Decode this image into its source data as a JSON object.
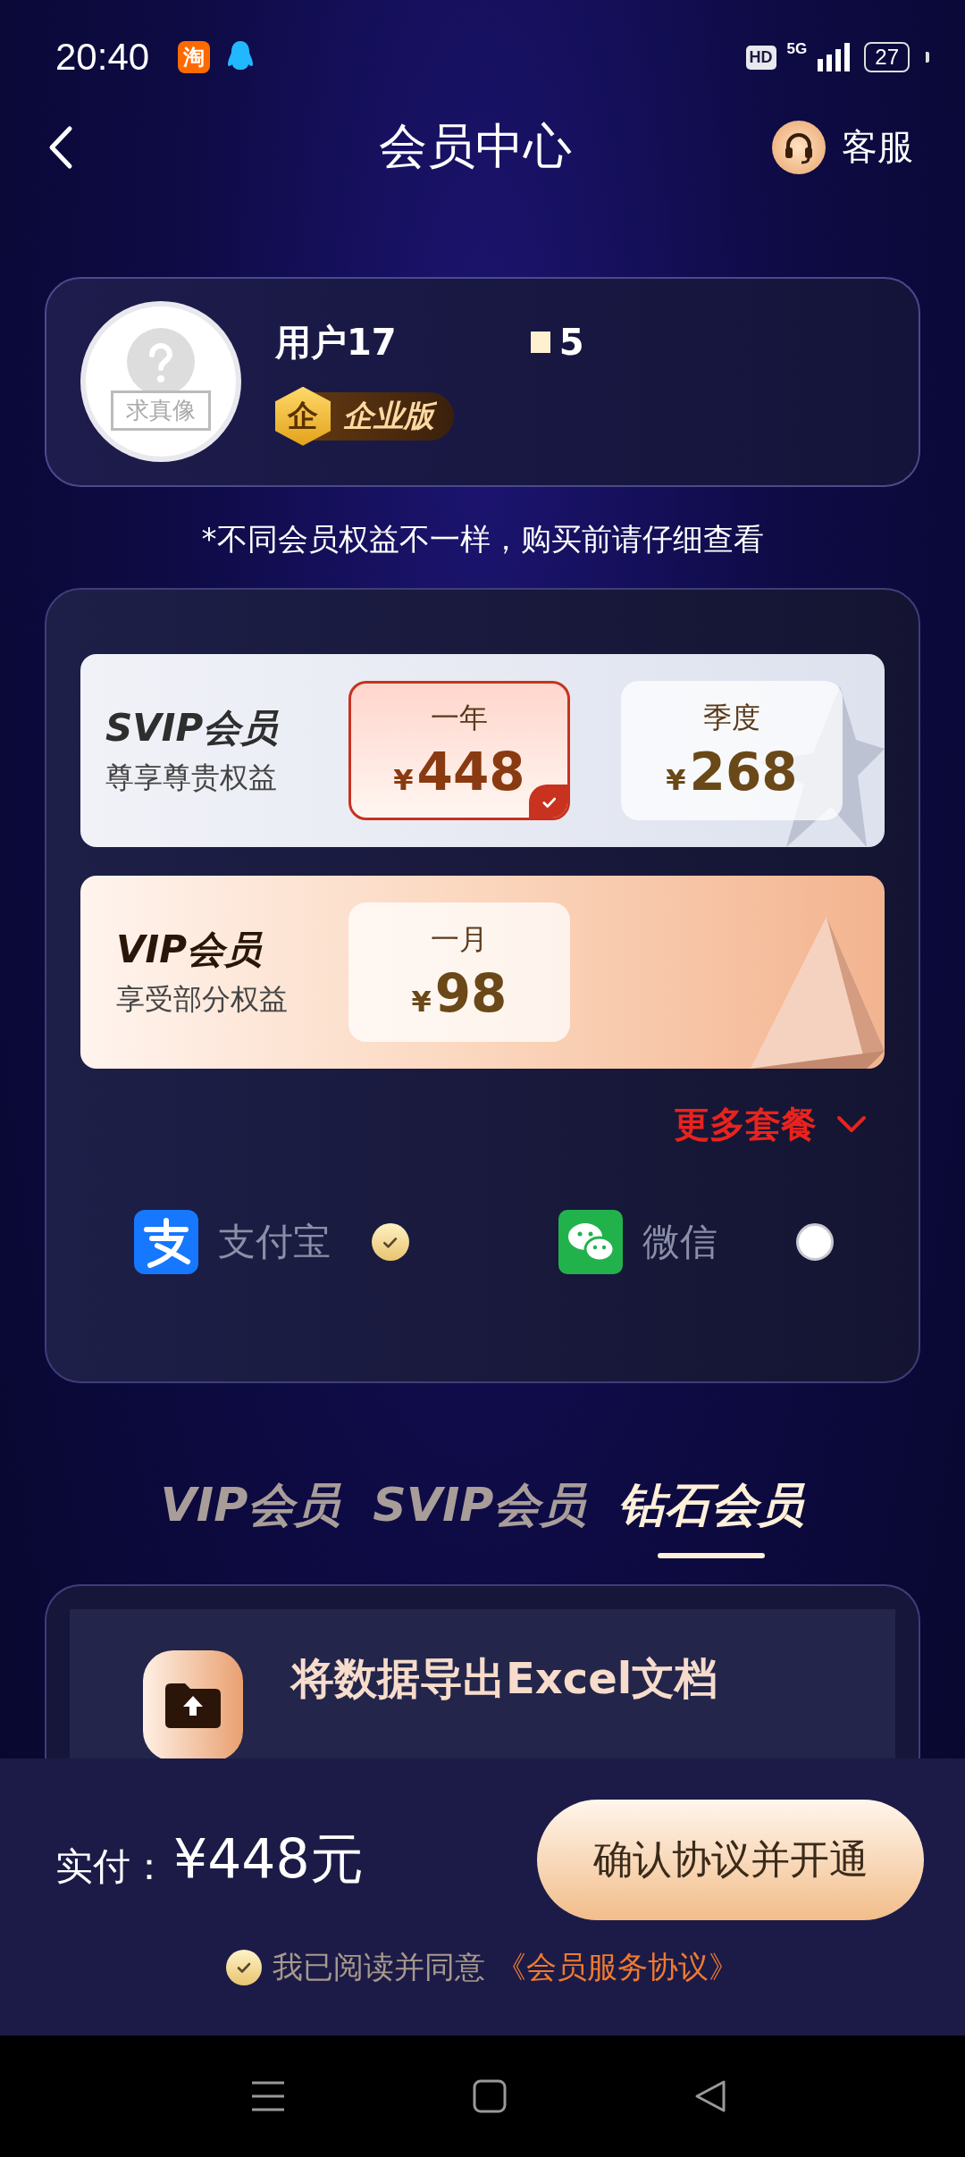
{
  "status_bar": {
    "time": "20:40",
    "app_badge": "淘",
    "hd": "HD",
    "network": "5G",
    "battery": "27"
  },
  "header": {
    "title": "会员中心",
    "service": "客服"
  },
  "profile": {
    "avatar_label": "求真像",
    "name": "用户17",
    "name_tail": "5",
    "badge_emblem": "企",
    "badge": "企业版"
  },
  "notice": "*不同会员权益不一样，购买前请仔细查看",
  "plans": [
    {
      "kind": "svip",
      "title": "SVIP会员",
      "subtitle": "尊享尊贵权益",
      "options": [
        {
          "period": "一年",
          "currency": "¥",
          "price": "448",
          "selected": true
        },
        {
          "period": "季度",
          "currency": "¥",
          "price": "268",
          "selected": false
        }
      ]
    },
    {
      "kind": "vip",
      "title": "VIP会员",
      "subtitle": "享受部分权益",
      "options": [
        {
          "period": "一月",
          "currency": "¥",
          "price": "98",
          "selected": false
        }
      ]
    }
  ],
  "more_plans": "更多套餐",
  "payment_methods": [
    {
      "kind": "alipay",
      "label": "支付宝",
      "selected": true
    },
    {
      "kind": "wechat",
      "label": "微信",
      "selected": false
    }
  ],
  "tier_tabs": [
    {
      "label": "VIP会员",
      "selected": false
    },
    {
      "label": "SVIP会员",
      "selected": false
    },
    {
      "label": "钻石会员",
      "selected": true
    }
  ],
  "features": [
    {
      "title": "将数据导出Excel文档"
    }
  ],
  "pay_bar": {
    "label": "实付：",
    "amount": "¥448元",
    "button": "确认协议并开通",
    "agreed": true,
    "agreement_text": "我已阅读并同意",
    "agreement_link": "《会员服务协议》"
  }
}
